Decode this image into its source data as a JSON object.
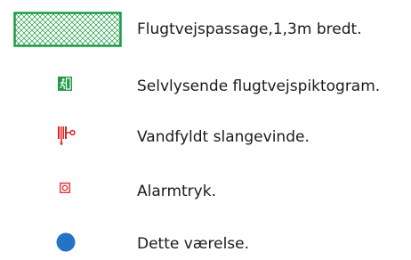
{
  "legend": {
    "items": [
      {
        "label": "Flugtvejspassage,1,3m bredt.",
        "icon": "hatched-passage-swatch",
        "color": "#1e9a45"
      },
      {
        "label": "Selvlysende flugtvejspiktogram.",
        "icon": "running-man-exit-icon",
        "color": "#1e9a45"
      },
      {
        "label": "Vandfyldt slangevinde.",
        "icon": "fire-hose-reel-icon",
        "color": "#e02020"
      },
      {
        "label": "Alarmtryk.",
        "icon": "alarm-button-icon",
        "color": "#e02020"
      },
      {
        "label": "Dette værelse.",
        "icon": "blue-dot-icon",
        "color": "#2473c4"
      }
    ]
  }
}
